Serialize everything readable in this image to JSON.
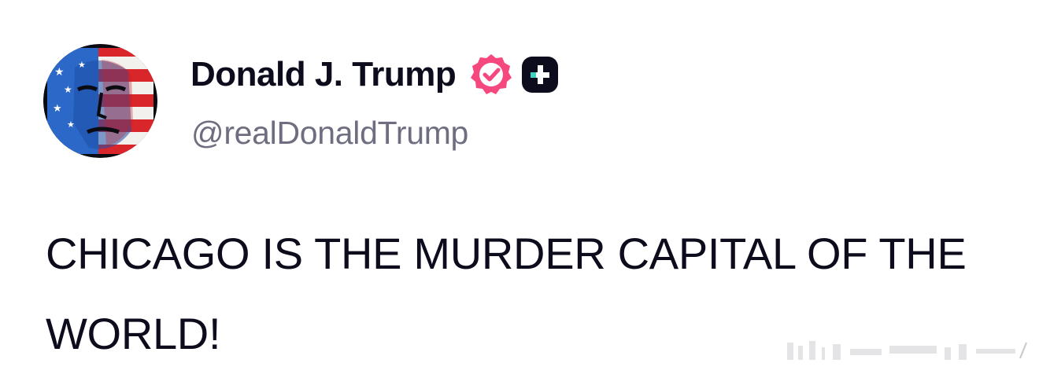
{
  "post": {
    "author": {
      "display_name": "Donald J. Trump",
      "handle": "@realDonaldTrump",
      "avatar_icon": "portrait-flag-avatar",
      "verified_icon": "verified-badge-icon",
      "verified_color": "#f5487e",
      "plus_icon": "truth-plus-badge-icon"
    },
    "text": "CHICAGO IS THE MURDER CAPITAL OF THE WORLD!"
  }
}
